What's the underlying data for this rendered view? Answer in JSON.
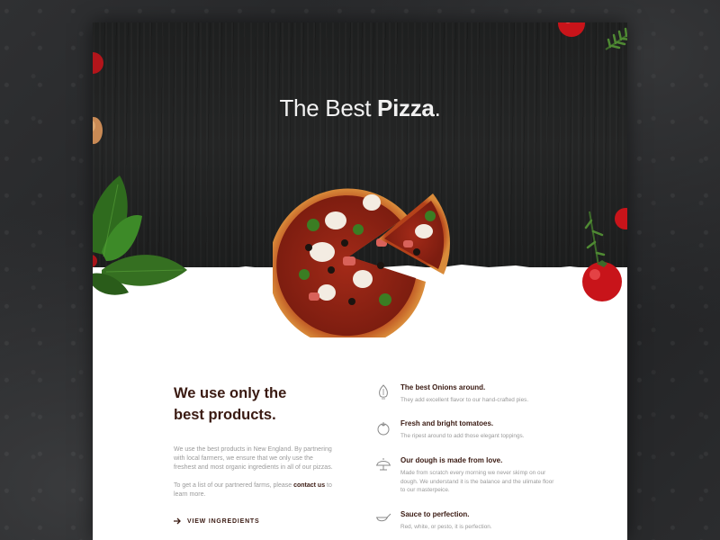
{
  "hero": {
    "title_prefix": "The Best ",
    "title_bold": "Pizza",
    "title_suffix": "."
  },
  "intro": {
    "heading_line1": "We use only the",
    "heading_line2": "best products.",
    "paragraph1": "We use the best products in New England. By partnering with local farmers, we ensure that we only use the freshest and most organic ingredients in all of our pizzas.",
    "paragraph2_before": "To get a list of our partnered farms, please ",
    "paragraph2_link": "contact us",
    "paragraph2_after": " to learn more.",
    "cta_label": "VIEW INGREDIENTS",
    "cta_icon": "arrow-right-icon"
  },
  "features": [
    {
      "icon": "onion-icon",
      "title": "The best Onions around.",
      "description": "They add excellent flavor to our hand-crafted pies."
    },
    {
      "icon": "tomato-icon",
      "title": "Fresh and bright tomatoes.",
      "description": "The ripest around to add those elegant toppings."
    },
    {
      "icon": "dough-icon",
      "title": "Our dough is made from love.",
      "description": "Made from scratch every morning we never skimp on our dough. We understand it is the balance and the ulimate floor to our masterpeice."
    },
    {
      "icon": "sauce-icon",
      "title": "Sauce to perfection.",
      "description": "Red, white, or pesto, it is perfection."
    }
  ],
  "colors": {
    "heading": "#3a1a12",
    "body": "#9a9a9a",
    "hero_bg": "#222323"
  }
}
